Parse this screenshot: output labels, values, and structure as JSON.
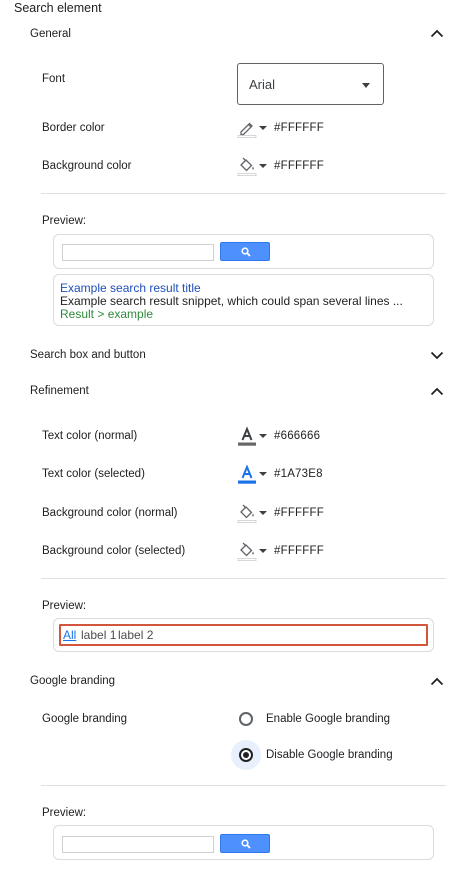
{
  "page": {
    "title": "Search element"
  },
  "general": {
    "title": "General",
    "font_label": "Font",
    "font_value": "Arial",
    "border_label": "Border color",
    "border_value": "#FFFFFF",
    "background_label": "Background color",
    "background_value": "#FFFFFF",
    "preview_label": "Preview:",
    "result_title": "Example search result title",
    "result_snippet": "Example search result snippet, which could span several lines ...",
    "result_url": "Result > example"
  },
  "search_box": {
    "title": "Search box and button"
  },
  "refinement": {
    "title": "Refinement",
    "text_normal_label": "Text color (normal)",
    "text_normal_value": "#666666",
    "text_selected_label": "Text color (selected)",
    "text_selected_value": "#1A73E8",
    "bg_normal_label": "Background color (normal)",
    "bg_normal_value": "#FFFFFF",
    "bg_selected_label": "Background color (selected)",
    "bg_selected_value": "#FFFFFF",
    "preview_label": "Preview:",
    "labels": [
      "All",
      "label 1",
      "label 2"
    ]
  },
  "branding": {
    "title": "Google branding",
    "field_label": "Google branding",
    "enable_label": "Enable Google branding",
    "disable_label": "Disable Google branding",
    "selected": "disable",
    "preview_label": "Preview:"
  },
  "colors": {
    "accent": "#1A73E8",
    "search_button": "#4D90FE",
    "refine_border": "#D2563B",
    "text_normal_swatch": "#666666",
    "text_selected_swatch": "#1A73E8"
  },
  "icons": {
    "expand_less": "chevron-up-icon",
    "expand_more": "chevron-down-icon",
    "border_picker": "pencil-icon",
    "fill_picker": "paint-bucket-icon",
    "text_color_picker": "text-color-icon",
    "search": "search-icon"
  }
}
